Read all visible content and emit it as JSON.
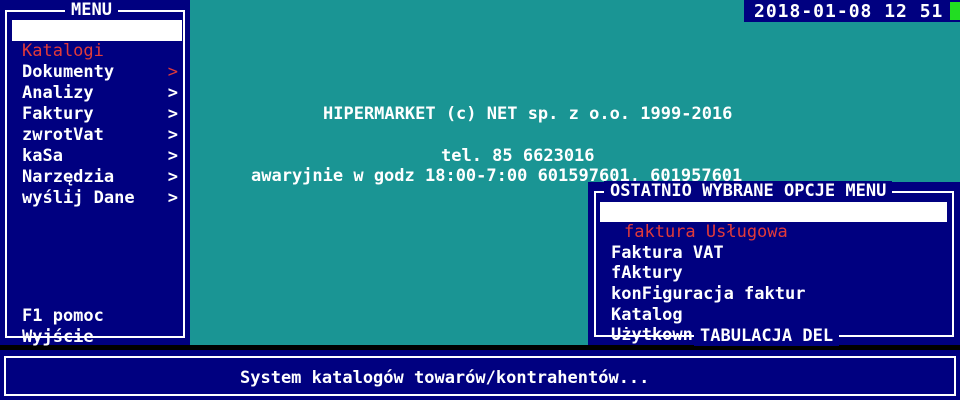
{
  "clock": {
    "datetime": "2018-01-08 12 51"
  },
  "menu": {
    "title": "MENU",
    "items": [
      {
        "label": "Katalogi",
        "arrow": ">",
        "selected": true
      },
      {
        "label": "Dokumenty",
        "arrow": ">"
      },
      {
        "label": "Analizy",
        "arrow": ">"
      },
      {
        "label": "Faktury",
        "arrow": ">"
      },
      {
        "label": "zwrotVat",
        "arrow": ">"
      },
      {
        "label": "kaSa",
        "arrow": ">"
      },
      {
        "label": "Narzędzia",
        "arrow": ">"
      },
      {
        "label": "wyślij Dane",
        "arrow": ""
      }
    ],
    "help": "F1 pomoc",
    "exit": "Wyjście"
  },
  "info": {
    "company": "HIPERMARKET (c) NET sp. z o.o. 1999-2016",
    "phone": "tel. 85 6623016",
    "emergency": "awaryjnie w godz 18:00-7:00 601597601, 601957601"
  },
  "recent": {
    "title": "OSTATNIO WYBRANE OPCJE MENU",
    "items": [
      {
        "label": "faktura Usługowa",
        "selected": true
      },
      {
        "label": "Faktura VAT"
      },
      {
        "label": "fAktury"
      },
      {
        "label": "konFiguracja faktur"
      },
      {
        "label": "Katalog"
      },
      {
        "label": "Użytkownicy"
      }
    ],
    "footer": "TABULACJA DEL"
  },
  "status": {
    "text": "System katalogów towarów/kontrahentów..."
  },
  "colors": {
    "background": "#1a9594",
    "panel": "#000080",
    "text": "#ffffff",
    "highlight_text": "#e03a3a",
    "cursor": "#22dd22"
  }
}
